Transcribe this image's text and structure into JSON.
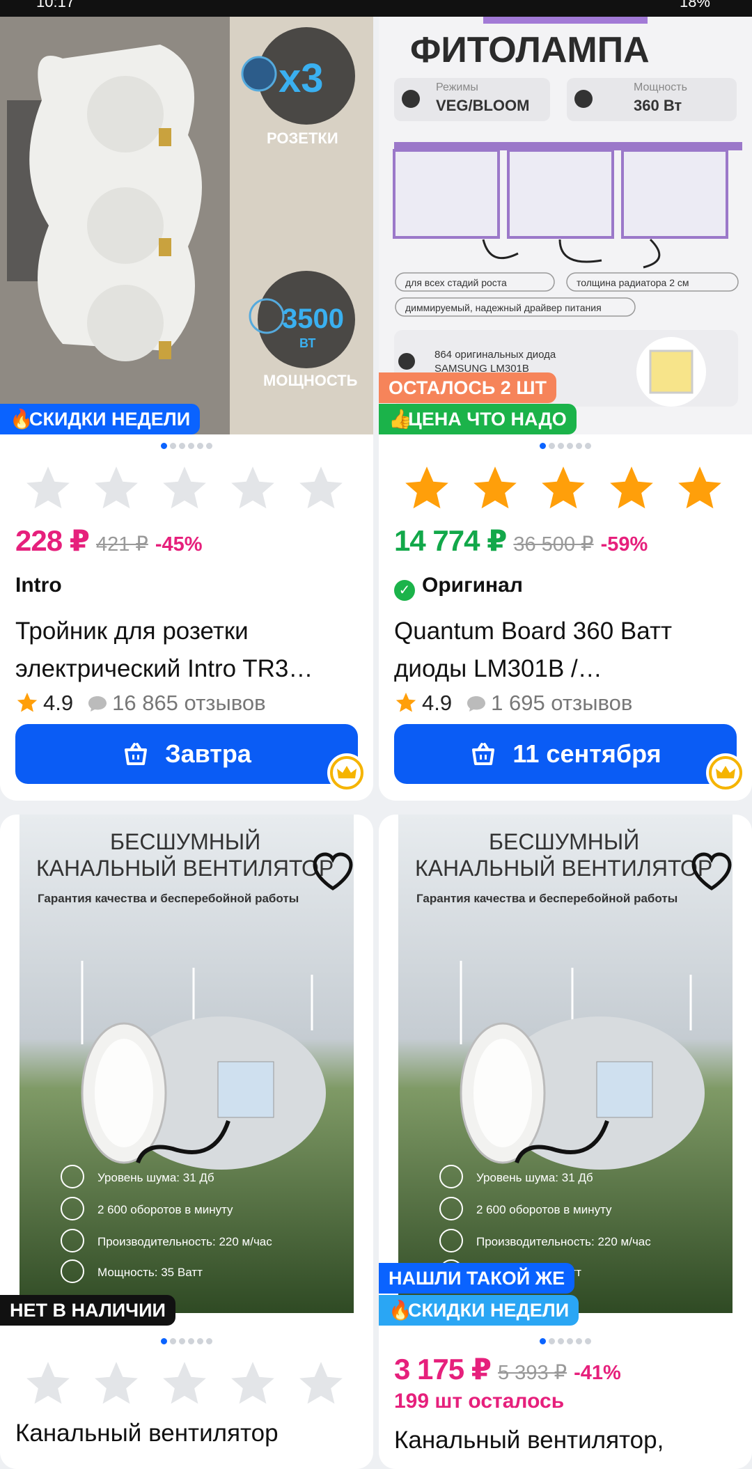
{
  "status": {
    "time": "10:17",
    "battery": "18%"
  },
  "badges": {
    "week_sale": "СКИДКИ НЕДЕЛИ",
    "left_2": "ОСТАЛОСЬ 2 ШТ",
    "good_price": "ЦЕНА ЧТО НАДО",
    "out_of_stock": "НЕТ В НАЛИЧИИ",
    "found_same": "НАШЛИ ТАКОЙ ЖЕ"
  },
  "products": [
    {
      "brand": "Intro",
      "title": "Тройник для розетки электрический Intro TR3…",
      "price": "228 ₽",
      "old_price": "421 ₽",
      "discount": "-45%",
      "rating": "4.9",
      "reviews": "16 865 отзывов",
      "delivery": "Завтра",
      "image_text": {
        "sockets": "РОЗЕТКИ",
        "x3": "x3",
        "power_val": "3500",
        "power_unit": "ВТ",
        "power": "МОЩНОСТЬ"
      },
      "stars_filled": 0
    },
    {
      "original": "Оригинал",
      "title": "Quantum Board 360 Ватт диоды LM301B /…",
      "price": "14 774 ₽",
      "old_price": "36 500 ₽",
      "discount": "-59%",
      "rating": "4.9",
      "reviews": "1 695 отзывов",
      "delivery": "11 сентября",
      "image_text": {
        "headline": "ФИТОЛАМПА",
        "mode_label": "Режимы",
        "mode_value": "VEG/BLOOM",
        "power_label": "Мощность",
        "power_value": "360 Вт",
        "tag1": "для всех стадий роста",
        "tag2": "толщина радиатора 2 см",
        "tag3": "диммируемый, надежный драйвер питания",
        "diodes": "864 оригинальных диода",
        "diodes2": "SAMSUNG LM301B"
      },
      "stars_filled": 5
    },
    {
      "title": "Канальный вентилятор",
      "image_text": {
        "h1": "БЕСШУМНЫЙ",
        "h2": "КАНАЛЬНЫЙ ВЕНТИЛЯТОР",
        "sub": "Гарантия качества и бесперебойной работы",
        "f1": "Уровень шума: 31 Дб",
        "f2": "2 600 оборотов в минуту",
        "f3": "Производительность: 220 м/час",
        "f4": "Мощность: 35 Ватт"
      },
      "stars_filled": 0
    },
    {
      "title": "Канальный вентилятор,",
      "price": "3 175 ₽",
      "old_price": "5 393 ₽",
      "discount": "-41%",
      "stock_left": "199 шт осталось",
      "image_text": {
        "h1": "БЕСШУМНЫЙ",
        "h2": "КАНАЛЬНЫЙ ВЕНТИЛЯТОР",
        "sub": "Гарантия качества и бесперебойной работы",
        "f1": "Уровень шума: 31 Дб",
        "f2": "2 600 оборотов в минуту",
        "f3": "Производительность: 220 м/час",
        "f4": "Мощность: 35 Ватт"
      }
    }
  ],
  "colors": {
    "accent": "#0a5cf5",
    "price": "#e6207c",
    "green": "#12a84a",
    "star": "#ff9f0a"
  }
}
